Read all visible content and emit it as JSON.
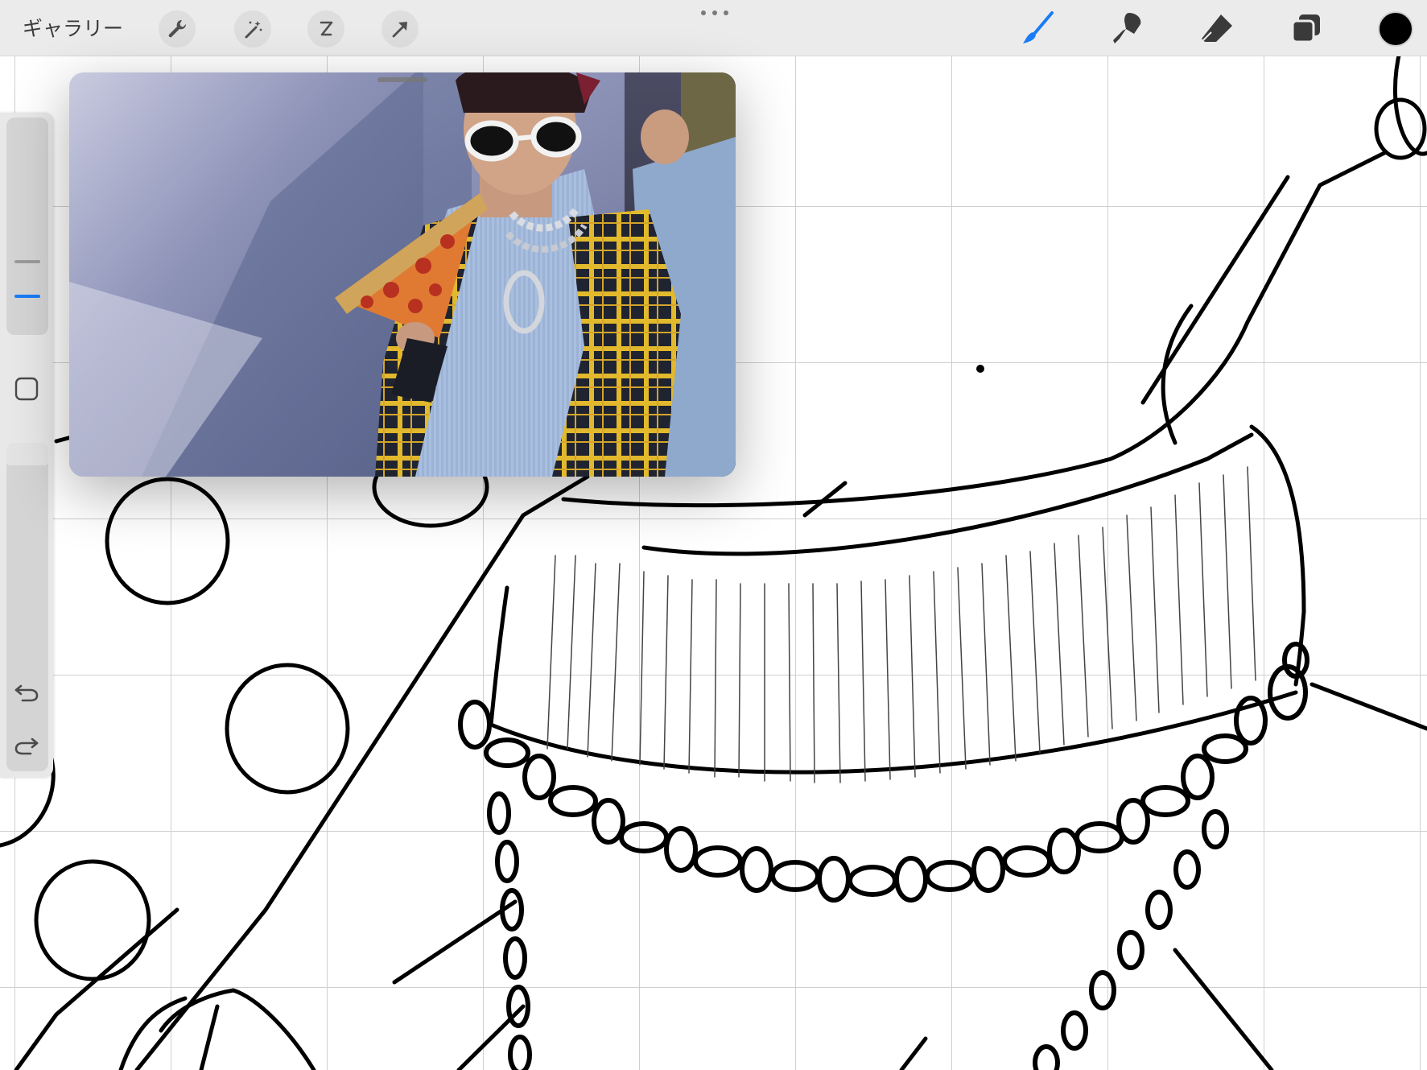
{
  "app": {
    "gallery_label": "ギャラリー"
  },
  "toolbar": {
    "left_tools": [
      {
        "icon": "wrench-icon",
        "label": "actions"
      },
      {
        "icon": "magic-wand-icon",
        "label": "adjustments"
      },
      {
        "icon": "selection-icon",
        "label": "selection"
      },
      {
        "icon": "arrow-icon",
        "label": "transform"
      }
    ],
    "right_tools": [
      {
        "icon": "brush-icon",
        "active": true
      },
      {
        "icon": "smudge-icon",
        "active": false
      },
      {
        "icon": "eraser-icon",
        "active": false
      },
      {
        "icon": "layers-icon",
        "active": false
      }
    ],
    "current_color": "#000000",
    "accent_color": "#1a7cf5"
  },
  "sidebar": {
    "controls": [
      "brush-size-slider",
      "modify-button",
      "opacity-slider",
      "undo-icon",
      "redo-icon"
    ]
  },
  "reference_window": {
    "content": "photo"
  }
}
